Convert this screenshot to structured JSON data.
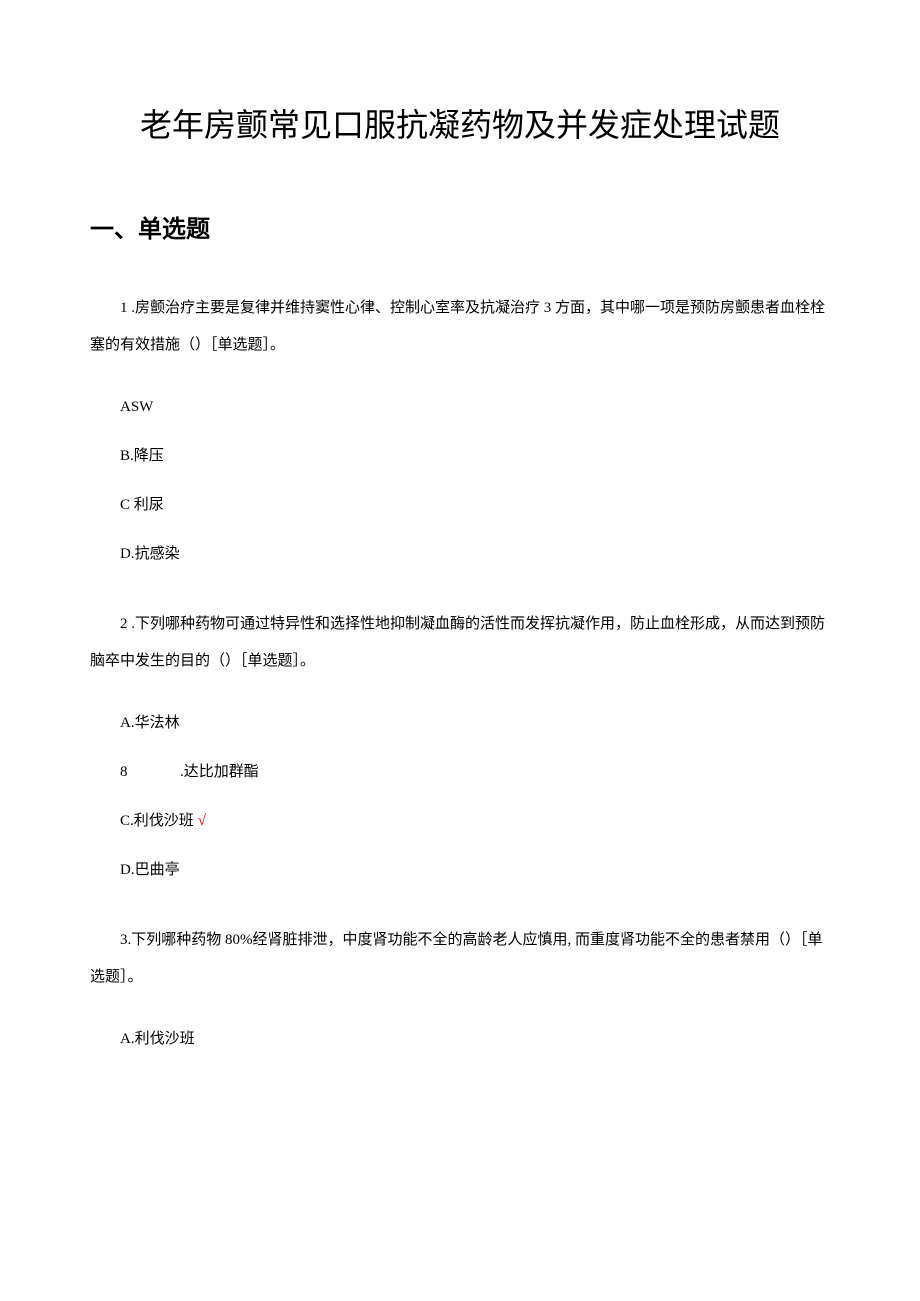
{
  "title": "老年房颤常见口服抗凝药物及并发症处理试题",
  "section_header": "一、单选题",
  "questions": [
    {
      "text": "1 .房颤治疗主要是复律并维持窦性心律、控制心室率及抗凝治疗 3 方面，其中哪一项是预防房颤患者血栓栓塞的有效措施（）［单选题］。",
      "options": [
        {
          "label": "ASW",
          "correct": false
        },
        {
          "label": "B.降压",
          "correct": false
        },
        {
          "label": "C 利尿",
          "correct": false
        },
        {
          "label": "D.抗感染",
          "correct": false
        }
      ]
    },
    {
      "text": "2 .下列哪种药物可通过特异性和选择性地抑制凝血酶的活性而发挥抗凝作用，防止血栓形成，从而达到预防脑卒中发生的目的（）［单选题］。",
      "options": [
        {
          "label": "A.华法林",
          "correct": false
        },
        {
          "label_num": "8",
          "label_text": ".达比加群酯",
          "special_format": true,
          "correct": false
        },
        {
          "label": "C.利伐沙班",
          "correct": true
        },
        {
          "label": "D.巴曲亭",
          "correct": false
        }
      ]
    },
    {
      "text": "3.下列哪种药物 80%经肾脏排泄，中度肾功能不全的高龄老人应慎用, 而重度肾功能不全的患者禁用（）［单选题］。",
      "options": [
        {
          "label": "A.利伐沙班",
          "correct": false
        }
      ]
    }
  ],
  "check_mark": "√"
}
